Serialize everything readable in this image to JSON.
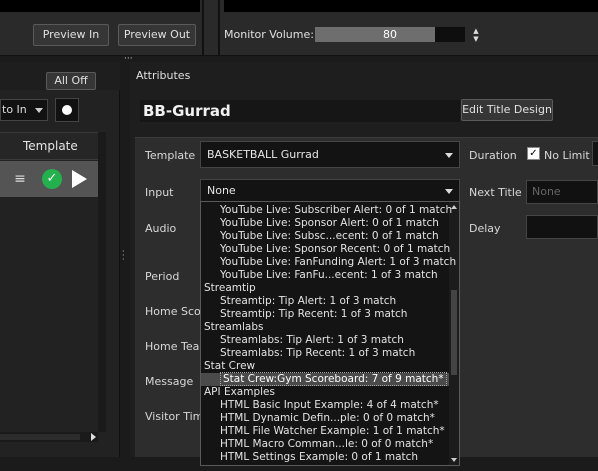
{
  "toolbar": {
    "preview_in": "Preview In",
    "preview_out": "Preview Out",
    "monitor_volume_label": "Monitor Volume:",
    "monitor_volume_value": "80",
    "monitor_volume_fraction": 0.8
  },
  "left_panel": {
    "all_off": "All Off",
    "transition_select": "to In",
    "template_header": "Template"
  },
  "attributes": {
    "heading": "Attributes",
    "title_name": "BB-Gurrad",
    "edit_title_design": "Edit Title Design",
    "labels": {
      "template": "Template",
      "input": "Input",
      "audio": "Audio",
      "period": "Period",
      "home_score": "Home Score",
      "home_team": "Home Team",
      "message": "Message",
      "visitor_time": "Visitor Time",
      "duration": "Duration",
      "next_title": "Next Title",
      "delay": "Delay"
    },
    "template_value": "BASKETBALL Gurrad",
    "input_value": "None",
    "no_limit_label": "No Limit",
    "no_limit_checked": true,
    "next_title_placeholder": "None"
  },
  "input_dropdown": {
    "items": [
      {
        "text": "YouTube Live: Subscriber Alert: 0 of 1 match",
        "kind": "sub"
      },
      {
        "text": "YouTube Live: Sponsor Alert: 0 of 1 match",
        "kind": "sub"
      },
      {
        "text": "YouTube Live: Subsc...ecent: 0 of 1 match",
        "kind": "sub"
      },
      {
        "text": "YouTube Live: Sponsor Recent: 0 of 1 match",
        "kind": "sub"
      },
      {
        "text": "YouTube Live: FanFunding Alert: 1 of 3 match",
        "kind": "sub"
      },
      {
        "text": "YouTube Live: FanFu...ecent: 1 of 3 match",
        "kind": "sub"
      },
      {
        "text": "Streamtip",
        "kind": "grp"
      },
      {
        "text": "Streamtip: Tip Alert: 1 of 3 match",
        "kind": "sub"
      },
      {
        "text": "Streamtip: Tip Recent: 1 of 3 match",
        "kind": "sub"
      },
      {
        "text": "Streamlabs",
        "kind": "grp"
      },
      {
        "text": "Streamlabs: Tip Alert: 1 of 3 match",
        "kind": "sub"
      },
      {
        "text": "Streamlabs: Tip Recent: 1 of 3 match",
        "kind": "sub"
      },
      {
        "text": "Stat Crew",
        "kind": "grp"
      },
      {
        "text": "Stat Crew:Gym Scoreboard: 7 of 9 match*",
        "kind": "sub",
        "selected": true
      },
      {
        "text": "API Examples",
        "kind": "grp"
      },
      {
        "text": "HTML Basic Input Example: 4 of 4 match*",
        "kind": "sub"
      },
      {
        "text": "HTML Dynamic Defin...ple: 0 of 0 match*",
        "kind": "sub"
      },
      {
        "text": "HTML File Watcher Example: 1 of 1 match*",
        "kind": "sub"
      },
      {
        "text": "HTML Macro Comman...le: 0 of 0 match*",
        "kind": "sub"
      },
      {
        "text": "HTML Settings Example: 0 of 1 match",
        "kind": "sub"
      }
    ]
  },
  "colors": {
    "check_green": "#22b14c",
    "selection_bg": "#4a4a4a"
  }
}
